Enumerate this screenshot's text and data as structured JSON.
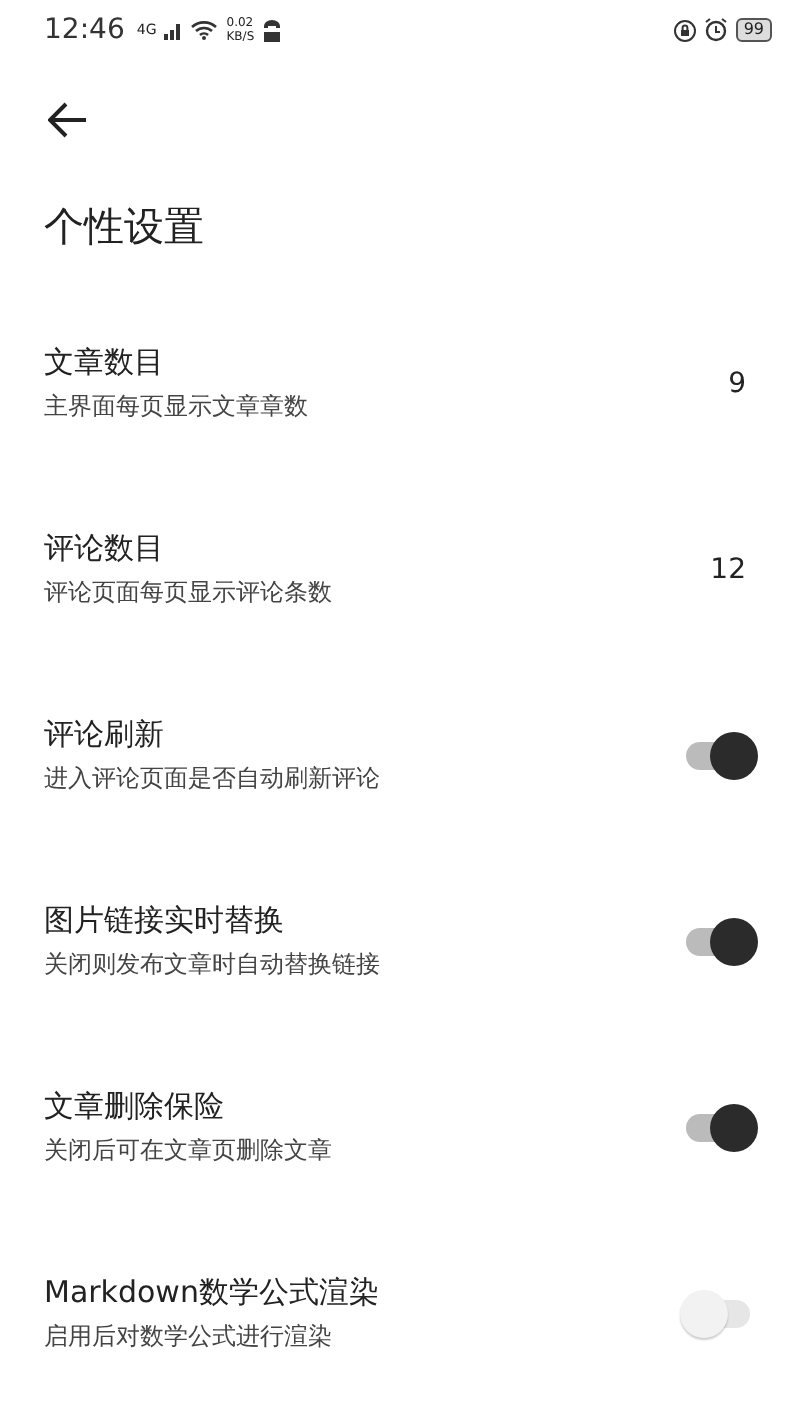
{
  "status_bar": {
    "time": "12:46",
    "network": "4G",
    "speed": "0.02",
    "speed_unit": "KB/S",
    "battery": "99"
  },
  "title": "个性设置",
  "settings": [
    {
      "kind": "value",
      "title": "文章数目",
      "subtitle": "主界面每页显示文章章数",
      "value": "9"
    },
    {
      "kind": "value",
      "title": "评论数目",
      "subtitle": "评论页面每页显示评论条数",
      "value": "12"
    },
    {
      "kind": "switch",
      "title": "评论刷新",
      "subtitle": "进入评论页面是否自动刷新评论",
      "on": true
    },
    {
      "kind": "switch",
      "title": "图片链接实时替换",
      "subtitle": "关闭则发布文章时自动替换链接",
      "on": true
    },
    {
      "kind": "switch",
      "title": "文章删除保险",
      "subtitle": "关闭后可在文章页删除文章",
      "on": true
    },
    {
      "kind": "switch",
      "title": "Markdown数学公式渲染",
      "subtitle": "启用后对数学公式进行渲染",
      "on": false
    }
  ]
}
